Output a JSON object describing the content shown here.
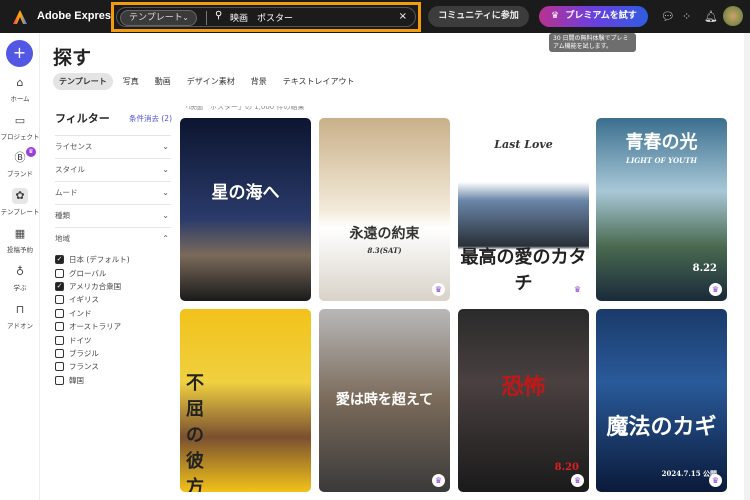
{
  "app": {
    "name": "Adobe Express"
  },
  "search": {
    "scope": "テンプレート",
    "query": "映画　ポスター"
  },
  "header": {
    "community": "コミュニティに参加",
    "premium": "プレミアムを試す",
    "tooltip": "30 日間の無料体験でプレミアム機能を試します。"
  },
  "rail": {
    "create": "+",
    "items": [
      {
        "label": "ホーム",
        "icon": "home-icon"
      },
      {
        "label": "プロジェクト",
        "icon": "folder-icon"
      },
      {
        "label": "ブランド",
        "icon": "brand-icon"
      },
      {
        "label": "テンプレート",
        "icon": "template-icon"
      },
      {
        "label": "投稿予約",
        "icon": "calendar-icon"
      },
      {
        "label": "学ぶ",
        "icon": "lightbulb-icon"
      },
      {
        "label": "アドオン",
        "icon": "addon-icon"
      }
    ]
  },
  "page": {
    "title": "探す",
    "tabs": [
      "テンプレート",
      "写真",
      "動画",
      "デザイン素材",
      "背景",
      "テキストレイアウト"
    ],
    "results": "「映画　ポスター」の 1,000 件の結果"
  },
  "filters": {
    "title": "フィルター",
    "clear": "条件消去 (2)",
    "facets": [
      "ライセンス",
      "スタイル",
      "ムード",
      "種類",
      "地域"
    ],
    "regions": [
      {
        "label": "日本 (デフォルト)",
        "checked": true
      },
      {
        "label": "グローバル",
        "checked": false
      },
      {
        "label": "アメリカ合衆国",
        "checked": true
      },
      {
        "label": "イギリス",
        "checked": false
      },
      {
        "label": "インド",
        "checked": false
      },
      {
        "label": "オーストラリア",
        "checked": false
      },
      {
        "label": "ドイツ",
        "checked": false
      },
      {
        "label": "ブラジル",
        "checked": false
      },
      {
        "label": "フランス",
        "checked": false
      },
      {
        "label": "韓国",
        "checked": false
      }
    ]
  },
  "templates": [
    {
      "title": "星の海へ",
      "premium": false
    },
    {
      "title": "永遠の約束",
      "sub": "8.3(SAT)",
      "premium": true
    },
    {
      "title": "最高の愛のカタチ",
      "sub": "Last Love",
      "premium": true
    },
    {
      "title": "青春の光",
      "sub": "LIGHT OF YOUTH",
      "date": "8.22",
      "premium": true
    },
    {
      "title": "不屈の彼方",
      "premium": false
    },
    {
      "title": "愛は時を超えて",
      "premium": true
    },
    {
      "title": "恐怖",
      "date": "8.20",
      "premium": true
    },
    {
      "title": "魔法のカギ",
      "date": "2024.7.15 公開",
      "premium": true
    }
  ]
}
